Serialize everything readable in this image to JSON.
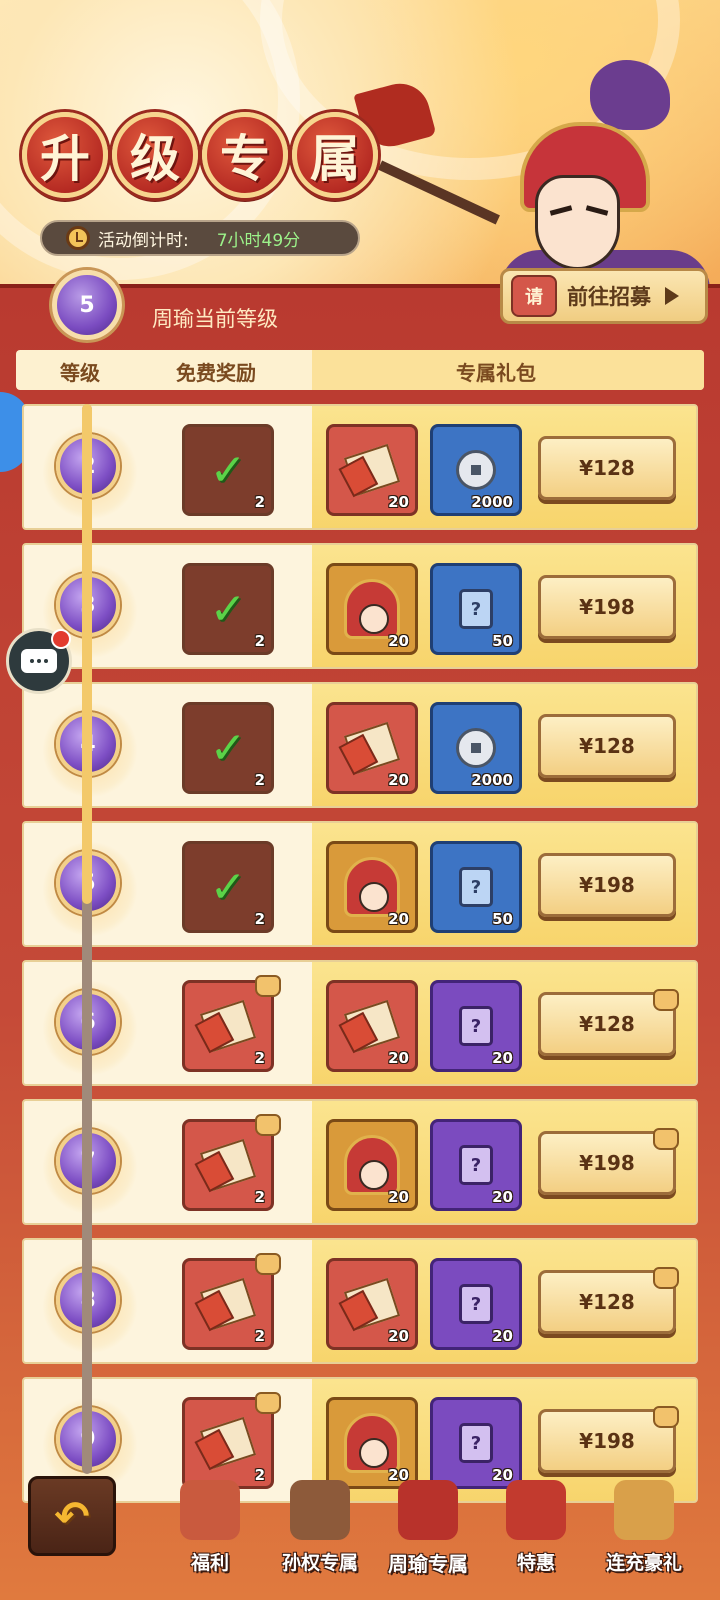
{
  "header": {
    "title_chars": [
      "升",
      "级",
      "专",
      "属"
    ],
    "countdown_label": "活动倒计时:",
    "countdown_value": "7小时49分",
    "recruit_button": "前往招募",
    "scroll_char": "请"
  },
  "current_level": {
    "value": "5",
    "label": "周瑜当前等级"
  },
  "columns": {
    "level": "等级",
    "free": "免费奖励",
    "exclusive": "专属礼包"
  },
  "rows": [
    {
      "level": "2",
      "free_qty": "2",
      "free_claimed": true,
      "item1_type": "scroll",
      "item1_qty": "20",
      "item2_type": "coin",
      "item2_qty": "2000",
      "price": "¥128",
      "locked": false
    },
    {
      "level": "3",
      "free_qty": "2",
      "free_claimed": true,
      "item1_type": "hero",
      "item1_qty": "20",
      "item2_type": "card-blue",
      "item2_qty": "50",
      "price": "¥198",
      "locked": false
    },
    {
      "level": "4",
      "free_qty": "2",
      "free_claimed": true,
      "item1_type": "scroll",
      "item1_qty": "20",
      "item2_type": "coin",
      "item2_qty": "2000",
      "price": "¥128",
      "locked": false
    },
    {
      "level": "5",
      "free_qty": "2",
      "free_claimed": true,
      "item1_type": "hero",
      "item1_qty": "20",
      "item2_type": "card-blue",
      "item2_qty": "50",
      "price": "¥198",
      "locked": false
    },
    {
      "level": "6",
      "free_qty": "2",
      "free_claimed": false,
      "item1_type": "scroll",
      "item1_qty": "20",
      "item2_type": "card-purple",
      "item2_qty": "20",
      "price": "¥128",
      "locked": true
    },
    {
      "level": "7",
      "free_qty": "2",
      "free_claimed": false,
      "item1_type": "hero",
      "item1_qty": "20",
      "item2_type": "card-purple",
      "item2_qty": "20",
      "price": "¥198",
      "locked": true
    },
    {
      "level": "8",
      "free_qty": "2",
      "free_claimed": false,
      "item1_type": "scroll",
      "item1_qty": "20",
      "item2_type": "card-purple",
      "item2_qty": "20",
      "price": "¥128",
      "locked": true
    },
    {
      "level": "9",
      "free_qty": "2",
      "free_claimed": false,
      "item1_type": "hero",
      "item1_qty": "20",
      "item2_type": "card-purple",
      "item2_qty": "20",
      "price": "¥198",
      "locked": true
    }
  ],
  "card_glyph": "?",
  "nav": {
    "back_glyph": "↶",
    "tabs": [
      {
        "label": "福利",
        "icon": "scroll-icon",
        "color": "#c95a3e",
        "active": false
      },
      {
        "label": "孙权专属",
        "icon": "hero-icon",
        "color": "#8d5a3a",
        "active": false
      },
      {
        "label": "周瑜专属",
        "icon": "hero-icon",
        "color": "#b8322b",
        "active": true
      },
      {
        "label": "特惠",
        "icon": "bag-icon",
        "color": "#c23a2e",
        "active": false
      },
      {
        "label": "连充豪礼",
        "icon": "chest-icon",
        "color": "#d9a04a",
        "active": false
      }
    ]
  }
}
